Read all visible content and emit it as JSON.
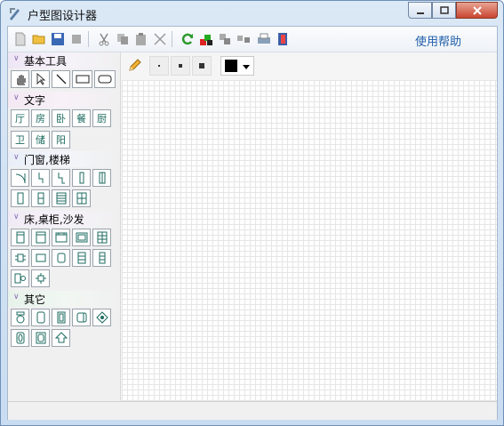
{
  "window": {
    "title": "户型图设计器",
    "app_icon": "pencil-ruler-icon",
    "controls": [
      "minimize-icon",
      "maximize-icon",
      "close-icon"
    ]
  },
  "toolbar": {
    "buttons": [
      {
        "name": "new-icon"
      },
      {
        "name": "open-folder-icon"
      },
      {
        "name": "save-icon"
      },
      {
        "name": "stop-icon"
      },
      {
        "name": "cut-icon"
      },
      {
        "name": "copy-icon"
      },
      {
        "name": "paste-icon"
      },
      {
        "name": "delete-icon"
      },
      {
        "name": "refresh-icon"
      },
      {
        "name": "shapes-icon"
      },
      {
        "name": "group-icon"
      },
      {
        "name": "ungroup-icon"
      },
      {
        "name": "print-icon"
      },
      {
        "name": "exit-door-icon"
      }
    ],
    "help_label": "使用帮助"
  },
  "sidebar": {
    "categories": [
      {
        "label": "基本工具",
        "items": [
          "hand-icon",
          "pointer-icon",
          "line-icon",
          "rectangle-icon",
          "rounded-rectangle-icon"
        ]
      },
      {
        "label": "文字",
        "items": [
          "厅",
          "房",
          "卧",
          "餐",
          "厨",
          "卫",
          "储",
          "阳"
        ]
      },
      {
        "label": "门窗,楼梯",
        "items": [
          "swing-door-icon",
          "door-left-icon",
          "door-right-icon",
          "window-single-icon",
          "window-double-icon",
          "sliding-door-icon",
          "folding-door-icon",
          "stairs-icon",
          "spiral-stairs-icon"
        ]
      },
      {
        "label": "床,桌柜,沙发",
        "items": [
          "bed-single-icon",
          "bed-double-icon",
          "bed-headboard-icon",
          "sofa-icon",
          "wardrobe-icon",
          "dining-table-icon",
          "coffee-table-icon",
          "chair-icon",
          "cabinet-icon",
          "shelf-icon",
          "desk-chair-icon",
          "round-table-icon"
        ]
      },
      {
        "label": "其它",
        "items": [
          "toilet-icon",
          "bathtub-icon",
          "fridge-icon",
          "sink-icon",
          "plant-icon",
          "washbasin-icon",
          "washing-machine-icon",
          "house-icon"
        ]
      }
    ]
  },
  "drawing_toolbar": {
    "tools": [
      "pencil-icon",
      "dot-small-icon",
      "dot-medium-icon",
      "dot-large-icon"
    ],
    "color": "#000000"
  }
}
